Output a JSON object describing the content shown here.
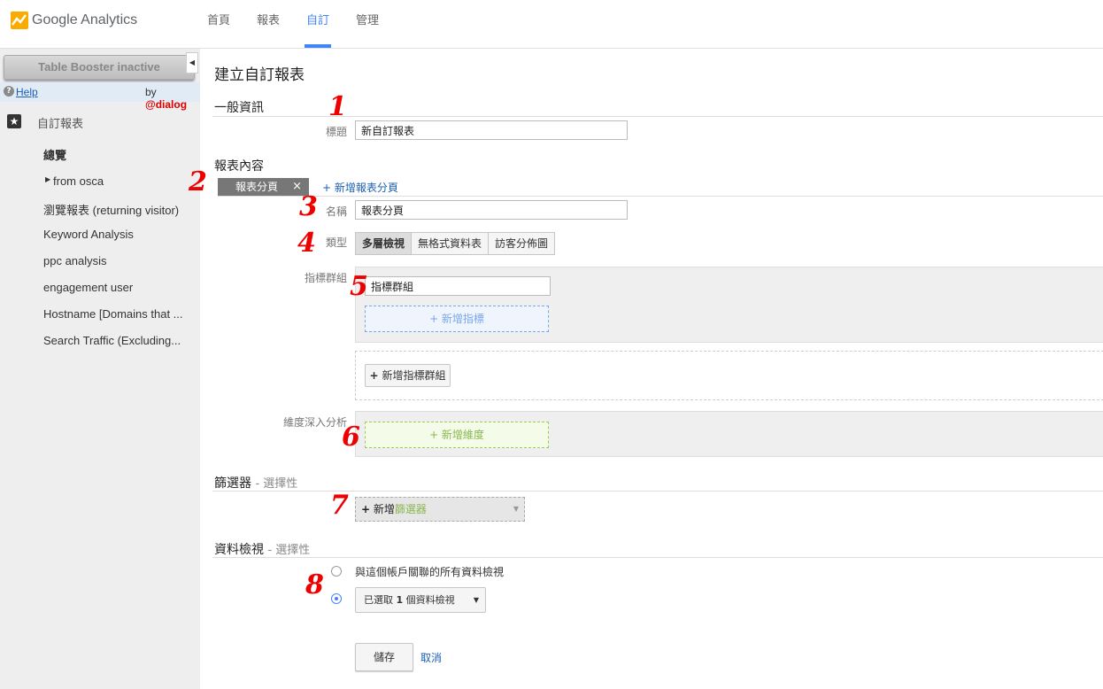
{
  "app": {
    "logo_text": "Google Analytics"
  },
  "nav": {
    "tabs": [
      {
        "label": "首頁"
      },
      {
        "label": "報表"
      },
      {
        "label": "自訂"
      },
      {
        "label": "管理"
      }
    ]
  },
  "sidebar": {
    "toolbar_button": "Table Booster inactive",
    "help_label": "Help",
    "by_label": "by",
    "brand": "dialog",
    "section_label": "自訂報表",
    "items": [
      {
        "label": "總覽"
      },
      {
        "label": "from osca"
      },
      {
        "label": "瀏覽報表 (returning visitor)"
      },
      {
        "label": "Keyword Analysis"
      },
      {
        "label": "ppc analysis"
      },
      {
        "label": "engagement user"
      },
      {
        "label": "Hostname [Domains that ..."
      },
      {
        "label": "Search Traffic (Excluding..."
      }
    ]
  },
  "main": {
    "page_title": "建立自訂報表",
    "general": {
      "heading": "一般資訊",
      "title_label": "標題",
      "title_value": "新自訂報表"
    },
    "content": {
      "heading": "報表內容",
      "tab_label": "報表分頁",
      "tab_close": "×",
      "add_tab": "+ 新增報表分頁",
      "name_label": "名稱",
      "name_value": "報表分頁",
      "type_label": "類型",
      "types": [
        {
          "label": "多層檢視"
        },
        {
          "label": "無格式資料表"
        },
        {
          "label": "訪客分佈圖"
        }
      ],
      "metric_group_label": "指標群組",
      "metric_group_value": "指標群組",
      "add_metric": "+ 新增指標",
      "add_metric_group": "新增指標群組",
      "dimension_label": "維度深入分析",
      "add_dimension": "+ 新增維度"
    },
    "filters": {
      "heading": "篩選器",
      "optional": "- 選擇性",
      "add_prefix": "新增",
      "add_suffix": "篩選器"
    },
    "views": {
      "heading": "資料檢視",
      "optional": "- 選擇性",
      "option_all": "與這個帳戶關聯的所有資料檢視",
      "selected_prefix": "已選取",
      "selected_count": "1",
      "selected_suffix": "個資料檢視"
    },
    "save_label": "儲存",
    "cancel_label": "取消"
  },
  "annotations": [
    "1",
    "2",
    "3",
    "4",
    "5",
    "6",
    "7",
    "8"
  ],
  "colors": {
    "accent": "#4285f4",
    "annotation": "#e00000",
    "sidebar_bg": "#eeeeee",
    "logo_orange": "#f9ab00"
  }
}
